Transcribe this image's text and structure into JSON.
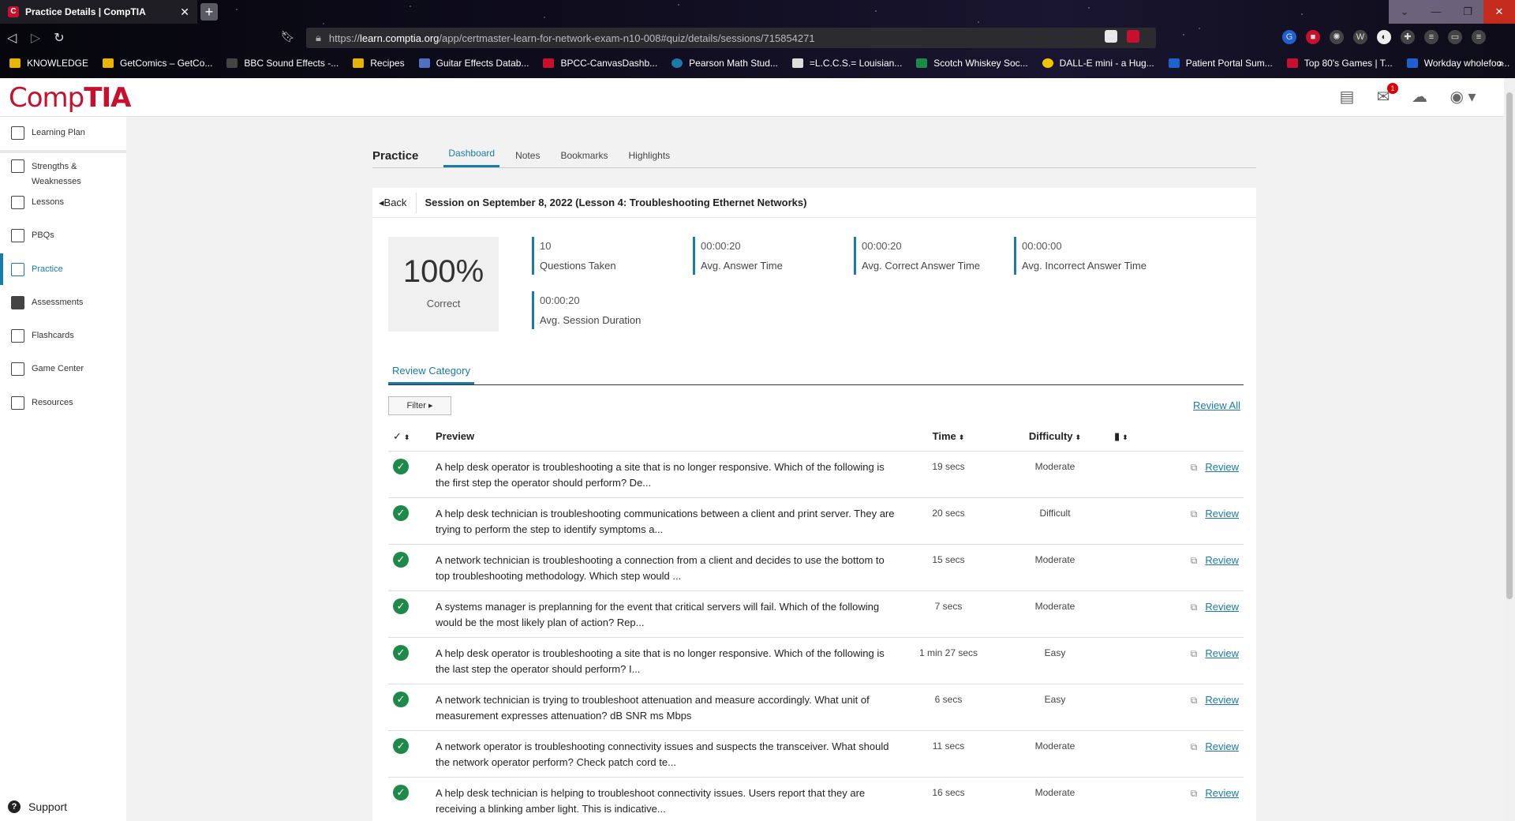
{
  "browser": {
    "tab_title": "Practice Details | CompTIA",
    "url_scheme": "https://",
    "url_host": "learn.comptia.org",
    "url_path": "/app/certmaster-learn-for-network-exam-n10-008#quiz/details/sessions/715854271",
    "bookmarks": [
      {
        "label": "KNOWLEDGE",
        "color": "#e8b400"
      },
      {
        "label": "GetComics – GetCo...",
        "color": "#e8b400"
      },
      {
        "label": "BBC Sound Effects -...",
        "color": "#444444"
      },
      {
        "label": "Recipes",
        "color": "#e8b400"
      },
      {
        "label": "Guitar Effects Datab...",
        "color": "#5070c0"
      },
      {
        "label": "BPCC-CanvasDashb...",
        "color": "#c8102e"
      },
      {
        "label": "Pearson Math Stud...",
        "color": "#1a7aa8"
      },
      {
        "label": "=L.C.C.S.= Louisian...",
        "color": "#dddddd"
      },
      {
        "label": "Scotch Whiskey Soc...",
        "color": "#1e8a4a"
      },
      {
        "label": "DALL-E mini - a Hug...",
        "color": "#f5c400"
      },
      {
        "label": "Patient Portal Sum...",
        "color": "#2060d0"
      },
      {
        "label": "Top 80's Games | T...",
        "color": "#c8102e"
      },
      {
        "label": "Workday wholefoo...",
        "color": "#2060d0"
      }
    ]
  },
  "header": {
    "logo_comp": "Comp",
    "logo_tia": "TIA",
    "mail_badge": "1"
  },
  "sidebar": {
    "items": [
      {
        "label": "Learning Plan"
      },
      {
        "label": "Strengths & Weaknesses"
      },
      {
        "label": "Lessons"
      },
      {
        "label": "PBQs"
      },
      {
        "label": "Practice"
      },
      {
        "label": "Assessments"
      },
      {
        "label": "Flashcards"
      },
      {
        "label": "Game Center"
      },
      {
        "label": "Resources"
      }
    ],
    "support": "Support"
  },
  "page": {
    "title": "Practice",
    "tabs": [
      "Dashboard",
      "Notes",
      "Bookmarks",
      "Highlights"
    ],
    "back": "Back",
    "session_title": "Session on September 8, 2022 (Lesson 4: Troubleshooting Ethernet Networks)",
    "score": "100%",
    "score_label": "Correct",
    "stats": [
      {
        "value": "10",
        "label": "Questions Taken"
      },
      {
        "value": "00:00:20",
        "label": "Avg. Answer Time"
      },
      {
        "value": "00:00:20",
        "label": "Avg. Correct Answer Time"
      },
      {
        "value": "00:00:00",
        "label": "Avg. Incorrect Answer Time"
      },
      {
        "value": "00:00:20",
        "label": "Avg. Session Duration"
      }
    ],
    "review_category": "Review Category",
    "filter": "Filter",
    "review_all": "Review All",
    "columns": {
      "check": "✓",
      "preview": "Preview",
      "time": "Time",
      "difficulty": "Difficulty"
    },
    "rows": [
      {
        "preview": "A help desk operator is troubleshooting a site that is no longer responsive. Which of the following is the first step the operator should perform? De...",
        "time": "19 secs",
        "difficulty": "Moderate",
        "review": "Review"
      },
      {
        "preview": "A help desk technician is troubleshooting communications between a client and print server. They are trying to perform the step to identify symptoms a...",
        "time": "20 secs",
        "difficulty": "Difficult",
        "review": "Review"
      },
      {
        "preview": "A network technician is troubleshooting a connection from a client and decides to use the bottom to top troubleshooting methodology. Which step would ...",
        "time": "15 secs",
        "difficulty": "Moderate",
        "review": "Review"
      },
      {
        "preview": "A systems manager is preplanning for the event that critical servers will fail. Which of the following would be the most likely plan of action? Rep...",
        "time": "7 secs",
        "difficulty": "Moderate",
        "review": "Review"
      },
      {
        "preview": "A help desk operator is troubleshooting a site that is no longer responsive. Which of the following is the last step the operator should perform? I...",
        "time": "1 min 27 secs",
        "difficulty": "Easy",
        "review": "Review"
      },
      {
        "preview": "A network technician is trying to troubleshoot attenuation and measure accordingly. What unit of measurement expresses attenuation? dB SNR ms Mbps",
        "time": "6 secs",
        "difficulty": "Easy",
        "review": "Review"
      },
      {
        "preview": "A network operator is troubleshooting connectivity issues and suspects the transceiver. What should the network operator perform? Check patch cord te...",
        "time": "11 secs",
        "difficulty": "Moderate",
        "review": "Review"
      },
      {
        "preview": "A help desk technician is helping to troubleshoot connectivity issues. Users report that they are receiving a blinking amber light. This is indicative...",
        "time": "16 secs",
        "difficulty": "Moderate",
        "review": "Review"
      }
    ]
  },
  "colors": {
    "accent": "#1a7aa8",
    "brand": "#c8102e",
    "success": "#1e8a4a"
  }
}
